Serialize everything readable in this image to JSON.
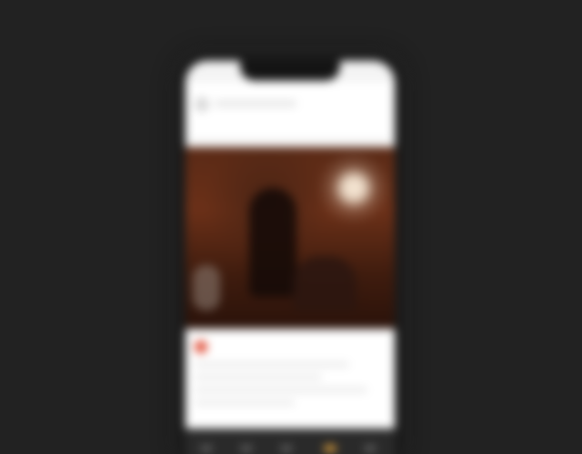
{
  "colors": {
    "background": "#222222",
    "phone_body": "#1b1b1b",
    "screen": "#f4f4f4",
    "video_tone": "#5a2a16",
    "accent": "#d79a3a",
    "like": "#e0503a"
  },
  "icons": {
    "like": "heart-icon",
    "avatar": "avatar"
  },
  "bottom_nav": {
    "items": [
      "home-icon",
      "search-icon",
      "add-icon",
      "activity-icon",
      "profile-icon"
    ],
    "active_index": 3
  }
}
